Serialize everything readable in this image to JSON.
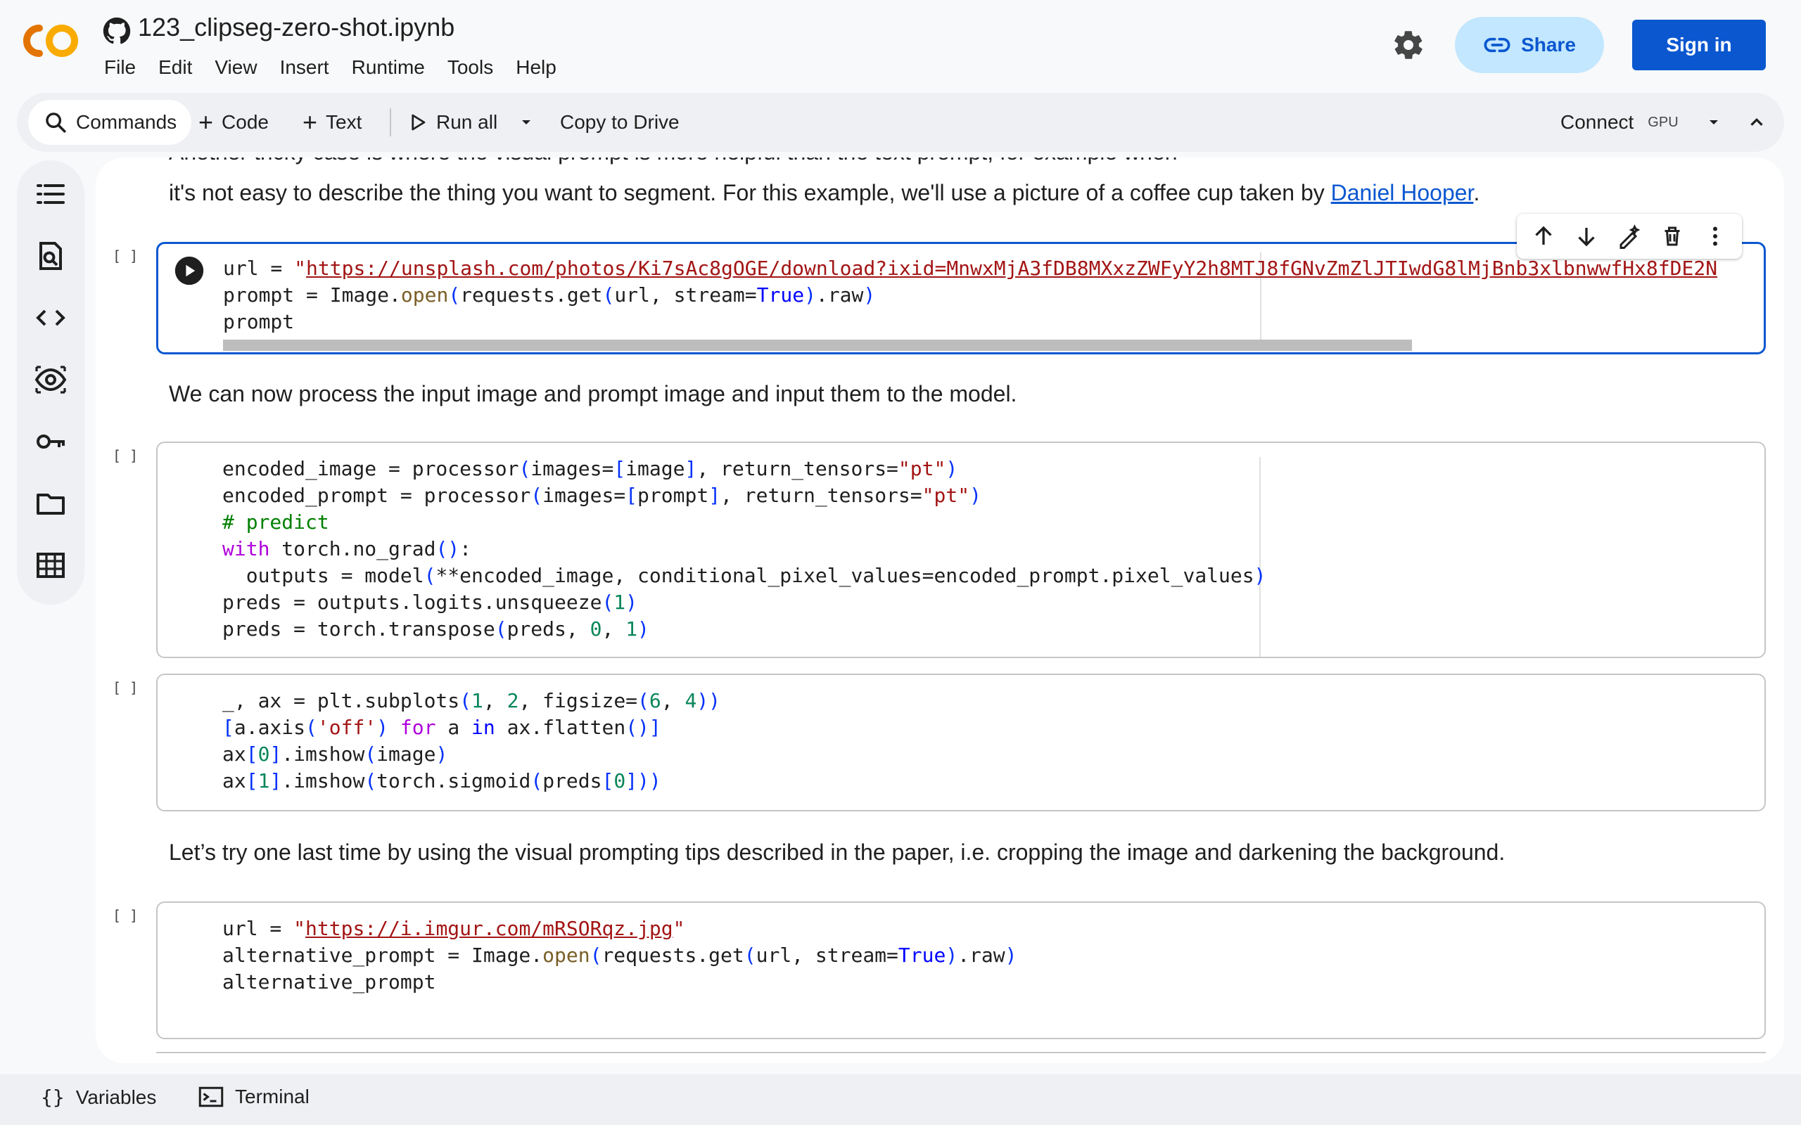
{
  "header": {
    "notebook_title": "123_clipseg-zero-shot.ipynb",
    "menu": [
      "File",
      "Edit",
      "View",
      "Insert",
      "Runtime",
      "Tools",
      "Help"
    ],
    "share_label": "Share",
    "signin_label": "Sign in",
    "brand_colors": {
      "orange": "#f9ab00",
      "dark_orange": "#e37400",
      "accent": "#0b57d0",
      "share_bg": "#c2e7ff"
    }
  },
  "toolbar": {
    "commands_label": "Commands",
    "code_label": "Code",
    "text_label": "Text",
    "run_all_label": "Run all",
    "copy_label": "Copy to Drive",
    "connect_label": "Connect",
    "gpu_label": "GPU"
  },
  "rail": {
    "icons": [
      "toc-icon",
      "find-icon",
      "code-snippets-icon",
      "secrets-icon",
      "key-icon",
      "folder-icon",
      "table-icon"
    ]
  },
  "notebook": {
    "md1": {
      "cut_line": "Another tricky case is where the visual prompt is more helpful than the text prompt, for example when",
      "text_before_link": "it's not easy to describe the thing you want to segment. For this example, we'll use a picture of a coffee cup taken by ",
      "link": "Daniel Hooper",
      "text_after_link": "."
    },
    "cells": [
      {
        "bracket": "[ ]"
      },
      {
        "bracket": "[ ]"
      },
      {
        "bracket": "[ ]"
      },
      {
        "bracket": "[ ]"
      }
    ],
    "cell1": {
      "url_prefix": "url = ",
      "url_value": "https://unsplash.com/photos/Ki7sAc8gOGE/download?ixid=MnwxMjA3fDB8MXxzZWFyY2h8MTJ8fGNvZmZlJTIwdG8lMjBnb3xlbnwwfHx8fDE2N",
      "line2": "prompt = Image.open(requests.get(url, stream=True).raw)",
      "line3": "prompt"
    },
    "md2": "We can now process the input image and prompt image and input them to the model.",
    "md3": "Let’s try one last time by using the visual prompting tips described in the paper, i.e. cropping the image and darkening the background.",
    "cell4": {
      "url_value": "https://i.imgur.com/mRSORqz.jpg",
      "line2": "alternative_prompt = Image.open(requests.get(url, stream=True).raw)",
      "line3": "alternative_prompt"
    }
  },
  "bottombar": {
    "variables_label": "Variables",
    "terminal_label": "Terminal"
  }
}
